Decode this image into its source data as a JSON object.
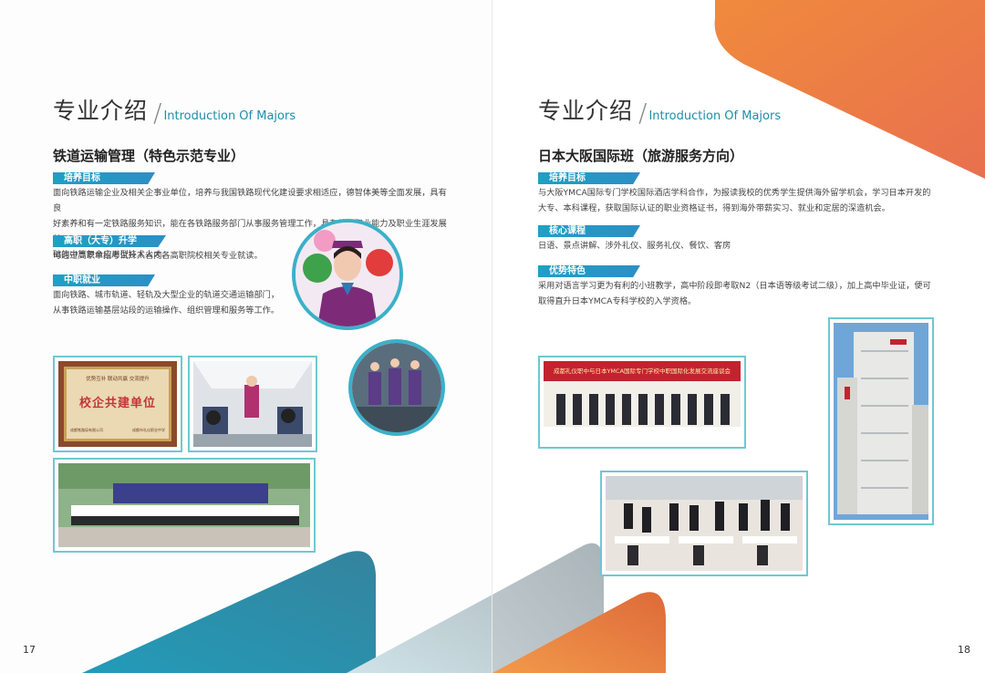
{
  "left": {
    "section_zh": "专业介绍",
    "section_en": "Introduction Of Majors",
    "major_title": "铁道运输管理（特色示范专业）",
    "blocks": [
      {
        "tag": "培养目标",
        "lines": [
          "面向铁路运输企业及相关企事业单位，培养与我国铁路现代化建设要求相适应，德智体美等全面发展，具有良",
          "好素养和有一定铁路服务知识，能在各铁路服务部门从事服务管理工作，具有综合职业能力及职业生涯发展基",
          "础的中等复合应用型技术人才。"
        ]
      },
      {
        "tag": "高职（大专）升学",
        "lines": [
          "可通过高职单招考试升入省内各高职院校相关专业就读。"
        ]
      },
      {
        "tag": "中职就业",
        "lines": [
          "面向铁路、城市轨道、轻轨及大型企业的轨道交通运输部门，",
          "从事铁路运输基层站段的运输操作、组织管理和服务等工作。"
        ]
      }
    ],
    "plaque": {
      "top": "优势互补  联动共赢  交流提升",
      "main": "校企共建单位",
      "bottom_left": "成都铁路局有限公司",
      "bottom_right": "成都市礼仪职业中学"
    },
    "page_number": "17"
  },
  "right": {
    "section_zh": "专业介绍",
    "section_en": "Introduction Of Majors",
    "major_title": "日本大阪国际班（旅游服务方向）",
    "blocks": [
      {
        "tag": "培养目标",
        "lines": [
          "与大阪YMCA国际专门学校国际酒店学科合作，为报读我校的优秀学生提供海外留学机会，学习日本开发的",
          "大专、本科课程，获取国际认证的职业资格证书，得到海外带薪实习、就业和定居的深造机会。"
        ]
      },
      {
        "tag": "核心课程",
        "lines": [
          "日语、景点讲解、涉外礼仪、服务礼仪、餐饮、客房"
        ]
      },
      {
        "tag": "优势特色",
        "lines": [
          "采用对语言学习更为有利的小班教学，高中阶段即考取N2（日本语等级考试二级），加上高中毕业证，便可",
          "取得直升日本YMCA专科学校的入学资格。"
        ]
      }
    ],
    "banner": "成都礼仪职中与日本YMCA国际专门学校中职国际化发展交流座谈会",
    "page_number": "18"
  },
  "colors": {
    "teal": "#1e8fa8",
    "frame": "#6fc8d2",
    "orange": "#ef7e3a",
    "red_banner": "#c2232f"
  }
}
